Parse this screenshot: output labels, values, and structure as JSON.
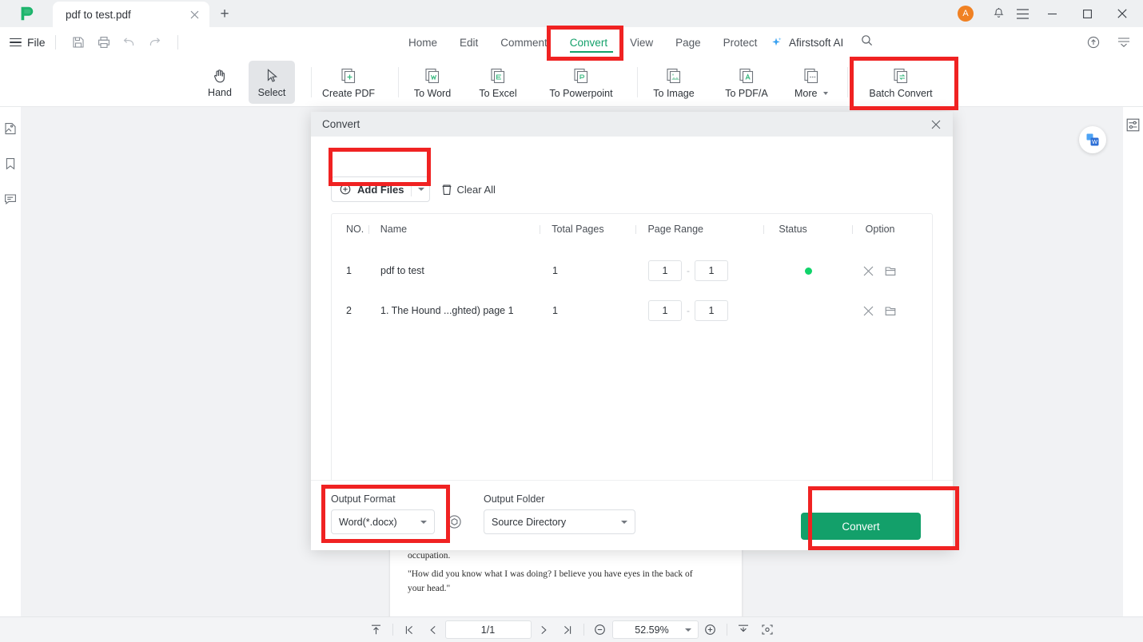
{
  "window": {
    "tab_title": "pdf to test.pdf",
    "new_tab_label": "+",
    "avatar_initial": "A",
    "logo_name": "afirstsoft-logo"
  },
  "menubar": {
    "file_label": "File",
    "quick_actions": [
      "save-icon",
      "print-icon",
      "undo-icon",
      "redo-icon"
    ],
    "tabs": [
      {
        "label": "Home",
        "active": false
      },
      {
        "label": "Edit",
        "active": false
      },
      {
        "label": "Comment",
        "active": false
      },
      {
        "label": "Convert",
        "active": true
      },
      {
        "label": "View",
        "active": false
      },
      {
        "label": "Page",
        "active": false
      },
      {
        "label": "Protect",
        "active": false
      }
    ],
    "ai_label": "Afirstsoft AI",
    "accent_green": "#13a06a"
  },
  "ribbon": {
    "items": [
      {
        "label": "Hand",
        "icon": "hand-icon",
        "selected": false
      },
      {
        "label": "Select",
        "icon": "cursor-icon",
        "selected": true
      },
      {
        "label": "Create PDF",
        "icon": "create-pdf-icon",
        "selected": false
      },
      {
        "label": "To Word",
        "icon": "to-word-icon",
        "selected": false
      },
      {
        "label": "To Excel",
        "icon": "to-excel-icon",
        "selected": false
      },
      {
        "label": "To Powerpoint",
        "icon": "to-powerpoint-icon",
        "selected": false
      },
      {
        "label": "To Image",
        "icon": "to-image-icon",
        "selected": false
      },
      {
        "label": "To PDF/A",
        "icon": "to-pdfa-icon",
        "selected": false
      },
      {
        "label": "More",
        "icon": "more-icon",
        "selected": false
      },
      {
        "label": "Batch Convert",
        "icon": "batch-convert-icon",
        "selected": false
      }
    ],
    "more_has_caret": true
  },
  "left_rail": {
    "items": [
      "thumbnails-icon",
      "bookmark-icon",
      "comment-icon"
    ]
  },
  "dialog": {
    "title": "Convert",
    "close_label": "×",
    "add_files_label": "Add Files",
    "clear_all_label": "Clear All",
    "columns": [
      "NO.",
      "Name",
      "Total Pages",
      "Page Range",
      "Status",
      "Option"
    ],
    "rows": [
      {
        "no": "1",
        "name": "pdf to test",
        "total_pages": "1",
        "range_from": "1",
        "range_to": "1",
        "status": "done",
        "status_color": "#10d36a"
      },
      {
        "no": "2",
        "name": "1. The Hound ...ghted) page 1",
        "total_pages": "1",
        "range_from": "1",
        "range_to": "1",
        "status": "",
        "status_color": ""
      }
    ],
    "range_separator": "-",
    "output_format_label": "Output Format",
    "output_format_value": "Word(*.docx)",
    "output_folder_label": "Output Folder",
    "output_folder_value": "Source Directory",
    "settings_icon": "gear-hexagon-icon",
    "convert_button_label": "Convert",
    "convert_button_color": "#13a06a"
  },
  "document": {
    "line1": "occupation.",
    "line2": "\"How did you know what I was doing? I believe you have eyes in the back of your head.\""
  },
  "statusbar": {
    "page_value": "1/1",
    "zoom_value": "52.59%",
    "icons": [
      "fit-top-icon",
      "first-page-icon",
      "prev-page-icon",
      "next-page-icon",
      "last-page-icon",
      "zoom-out-icon",
      "zoom-in-icon",
      "fit-width-icon",
      "fit-page-icon"
    ]
  },
  "annotations": {
    "highlight_color": "#f02222",
    "boxes": [
      "convert-tab",
      "batch-convert-button",
      "add-files-button",
      "output-format-group",
      "convert-action-button"
    ]
  }
}
